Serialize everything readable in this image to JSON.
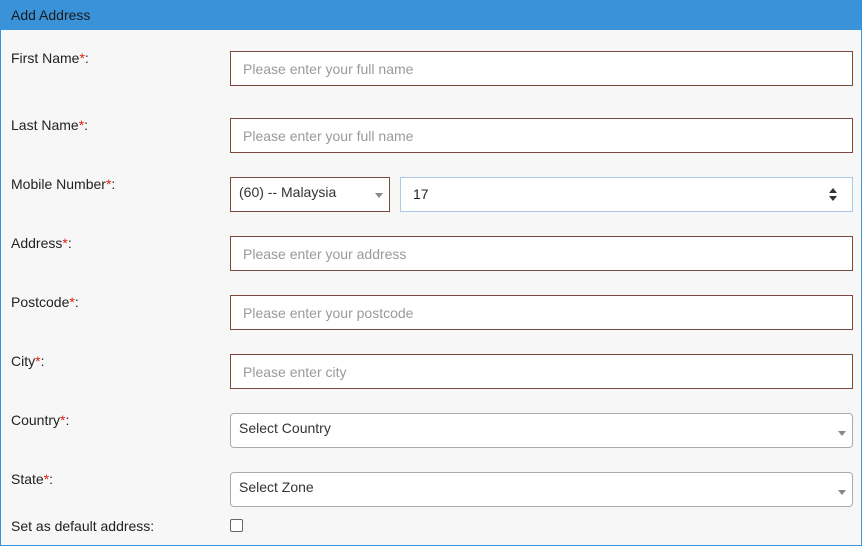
{
  "header": {
    "title": "Add Address"
  },
  "form": {
    "required_marker": "*",
    "first_name": {
      "label": "First Name",
      "suffix": ":",
      "placeholder": "Please enter your full name"
    },
    "last_name": {
      "label": "Last Name",
      "suffix": ":",
      "placeholder": "Please enter your full name"
    },
    "mobile": {
      "label": "Mobile Number",
      "suffix": ":",
      "country_code": "(60) -- Malaysia",
      "value": "17"
    },
    "address": {
      "label": "Address",
      "suffix": ":",
      "placeholder": "Please enter your address"
    },
    "postcode": {
      "label": "Postcode",
      "suffix": ":",
      "placeholder": "Please enter your postcode"
    },
    "city": {
      "label": "City",
      "suffix": ":",
      "placeholder": "Please enter city"
    },
    "country": {
      "label": "Country",
      "suffix": ":",
      "selected": "Select Country"
    },
    "state": {
      "label": "State",
      "suffix": ":",
      "selected": "Select Zone"
    },
    "default_address": {
      "label": "Set as default address:",
      "checked": false
    }
  },
  "colors": {
    "header_bg": "#3a92d8",
    "required": "#d9230f",
    "field_border": "#7a4a3f"
  }
}
